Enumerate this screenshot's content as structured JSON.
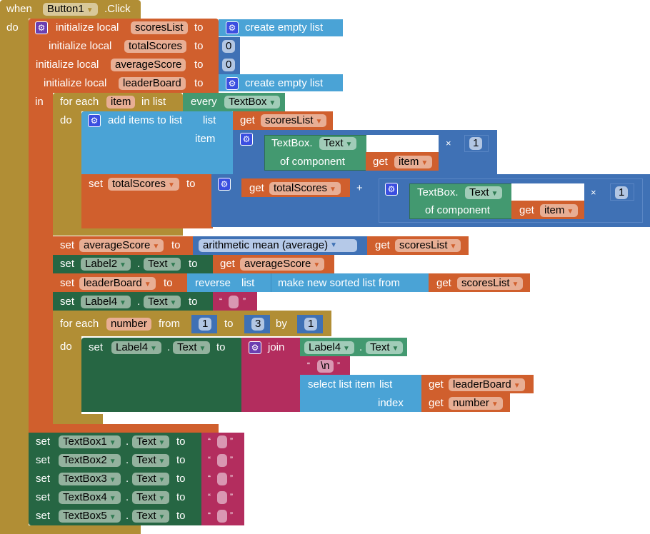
{
  "event": {
    "when": "when",
    "component": "Button1",
    "event_name": ".Click",
    "do": "do"
  },
  "init": [
    {
      "label": "initialize local",
      "var": "scoresList",
      "to": "to",
      "value": "create empty list"
    },
    {
      "label": "initialize local",
      "var": "totalScores",
      "to": "to",
      "value": "0"
    },
    {
      "label": "initialize local",
      "var": "averageScore",
      "to": "to",
      "value": "0"
    },
    {
      "label": "initialize local",
      "var": "leaderBoard",
      "to": "to",
      "value": "create empty list"
    }
  ],
  "in_label": "in",
  "foreach1": {
    "label": "for each",
    "var": "item",
    "in_list": "in list",
    "every": "every",
    "component_type": "TextBox",
    "do": "do"
  },
  "add_items": {
    "label": "add items to list",
    "list": "list",
    "item": "item",
    "get": "get",
    "list_var": "scoresList",
    "textbox": "TextBox.",
    "prop": "Text",
    "of_component": "of component",
    "item_var": "item",
    "times": "×",
    "mult": "1"
  },
  "set_total": {
    "set": "set",
    "var": "totalScores",
    "to": "to",
    "get": "get",
    "get_var": "totalScores",
    "plus": "+",
    "textbox": "TextBox.",
    "prop": "Text",
    "of_component": "of component",
    "item_var": "item",
    "times": "×",
    "mult": "1"
  },
  "set_avg": {
    "set": "set",
    "var": "averageScore",
    "to": "to",
    "op": "arithmetic mean (average)",
    "get": "get",
    "get_var": "scoresList"
  },
  "set_label2": {
    "set": "set",
    "component": "Label2",
    "dot": ".",
    "prop": "Text",
    "to": "to",
    "get": "get",
    "get_var": "averageScore"
  },
  "set_leader": {
    "set": "set",
    "var": "leaderBoard",
    "to": "to",
    "reverse": "reverse",
    "list": "list",
    "sorted": "make new sorted list from",
    "get": "get",
    "get_var": "scoresList"
  },
  "set_label4": {
    "set": "set",
    "component": "Label4",
    "dot": ".",
    "prop": "Text",
    "to": "to",
    "open_q": "“",
    "close_q": "”",
    "value": ""
  },
  "foreach2": {
    "label": "for each",
    "var": "number",
    "from": "from",
    "from_val": "1",
    "to": "to",
    "to_val": "3",
    "by": "by",
    "by_val": "1",
    "do": "do"
  },
  "inner_set": {
    "set": "set",
    "component": "Label4",
    "dot": ".",
    "prop": "Text",
    "to": "to",
    "join": "join",
    "j_component": "Label4",
    "j_prop": "Text",
    "newline": "\\n",
    "select": "select list item",
    "list": "list",
    "index": "index",
    "get": "get",
    "list_var": "leaderBoard",
    "index_var": "number"
  },
  "textbox_sets": [
    {
      "set": "set",
      "component": "TextBox1",
      "prop": "Text",
      "to": "to",
      "value": ""
    },
    {
      "set": "set",
      "component": "TextBox2",
      "prop": "Text",
      "to": "to",
      "value": ""
    },
    {
      "set": "set",
      "component": "TextBox3",
      "prop": "Text",
      "to": "to",
      "value": ""
    },
    {
      "set": "set",
      "component": "TextBox4",
      "prop": "Text",
      "to": "to",
      "value": ""
    },
    {
      "set": "set",
      "component": "TextBox5",
      "prop": "Text",
      "to": "to",
      "value": ""
    }
  ],
  "quote_open": "“",
  "quote_close": "”",
  "dot": "."
}
